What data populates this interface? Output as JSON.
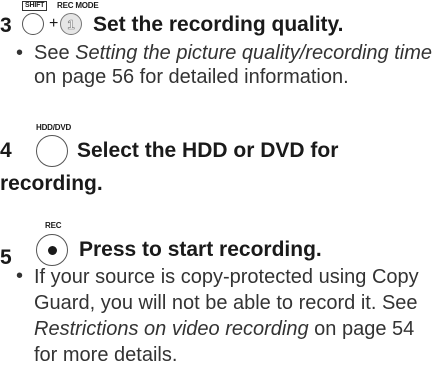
{
  "step3": {
    "number": "3",
    "shift_label": "SHIFT",
    "plus": "+",
    "recmode_label": "REC MODE",
    "button_glyph": "1",
    "heading": "Set the recording quality.",
    "bullet": {
      "pre": "See ",
      "link": "Setting the picture quality/recording time",
      "post": " on page 56 for detailed information."
    }
  },
  "step4": {
    "number": "4",
    "button_label": "HDD/DVD",
    "heading_line1": "Select the HDD or DVD for",
    "heading_line2": "recording."
  },
  "step5": {
    "number": "5",
    "button_label": "REC",
    "heading": "Press to start recording.",
    "bullet": {
      "pre": "If your source is copy-protected using Copy Guard, you will not be able to record it. See ",
      "link": "Restrictions on video recording",
      "post": " on page 54 for more details."
    }
  }
}
